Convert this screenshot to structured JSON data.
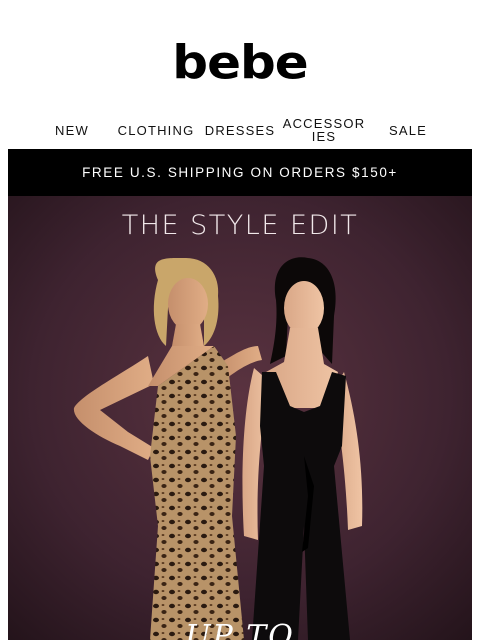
{
  "brand": {
    "logo": "bebe"
  },
  "nav": {
    "items": [
      {
        "label": "NEW"
      },
      {
        "label": "CLOTHING"
      },
      {
        "label": "DRESSES"
      },
      {
        "label": "ACCESSORIES"
      },
      {
        "label": "SALE"
      }
    ]
  },
  "promo_banner": {
    "text": "FREE U.S. SHIPPING ON ORDERS $150+"
  },
  "hero": {
    "title": "THE STYLE EDIT",
    "subtitle": "UP TO",
    "background_color": "#3a2129",
    "image": "two-models-leopard-dress-black-jumpsuit"
  }
}
